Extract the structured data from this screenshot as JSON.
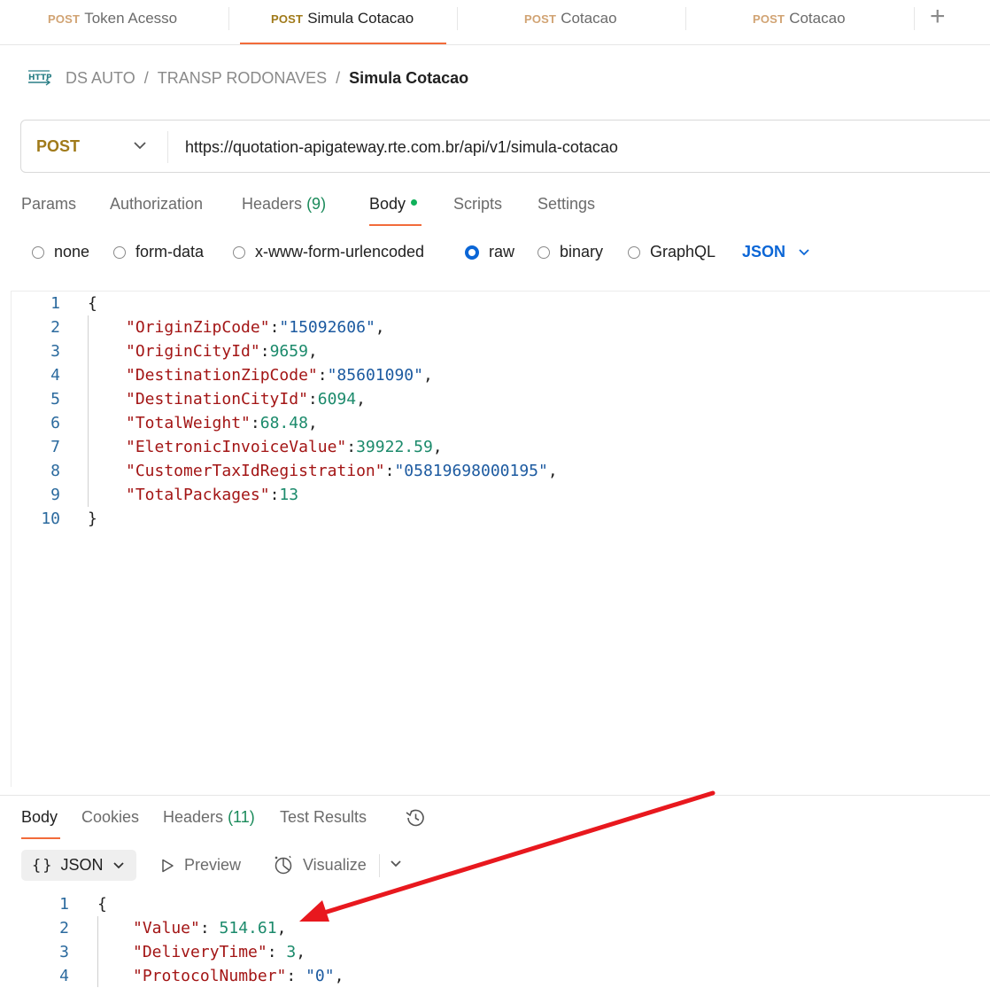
{
  "tabs": [
    {
      "method": "POST",
      "name": "Token Acesso",
      "active": false,
      "unsaved": false
    },
    {
      "method": "POST",
      "name": "Simula Cotacao",
      "active": true,
      "unsaved": true
    },
    {
      "method": "POST",
      "name": "Cotacao",
      "active": false,
      "unsaved": true
    },
    {
      "method": "POST",
      "name": "Cotacao",
      "active": false,
      "unsaved": false
    }
  ],
  "breadcrumb": {
    "icon": "http-icon",
    "parts": [
      "DS AUTO",
      "TRANSP RODONAVES"
    ],
    "separator": "/",
    "current": "Simula Cotacao"
  },
  "request": {
    "method": "POST",
    "url": "https://quotation-apigateway.rte.com.br/api/v1/simula-cotacao",
    "tabs": {
      "params": "Params",
      "authorization": "Authorization",
      "headers": "Headers",
      "headers_count": "(9)",
      "body": "Body",
      "scripts": "Scripts",
      "settings": "Settings"
    },
    "body_types": {
      "none": "none",
      "form_data": "form-data",
      "urlencoded": "x-www-form-urlencoded",
      "raw": "raw",
      "binary": "binary",
      "graphql": "GraphQL",
      "selected": "raw"
    },
    "format": "JSON",
    "body_lines": [
      {
        "n": "1",
        "k": "",
        "v": "",
        "t": "open"
      },
      {
        "n": "2",
        "k": "\"OriginZipCode\"",
        "v": "\"15092606\"",
        "t": "str",
        "c": ","
      },
      {
        "n": "3",
        "k": "\"OriginCityId\"",
        "v": "9659",
        "t": "num",
        "c": ","
      },
      {
        "n": "4",
        "k": "\"DestinationZipCode\"",
        "v": "\"85601090\"",
        "t": "str",
        "c": ","
      },
      {
        "n": "5",
        "k": "\"DestinationCityId\"",
        "v": "6094",
        "t": "num",
        "c": ","
      },
      {
        "n": "6",
        "k": "\"TotalWeight\"",
        "v": "68.48",
        "t": "num",
        "c": ","
      },
      {
        "n": "7",
        "k": "\"EletronicInvoiceValue\"",
        "v": "39922.59",
        "t": "num",
        "c": ","
      },
      {
        "n": "8",
        "k": "\"CustomerTaxIdRegistration\"",
        "v": "\"05819698000195\"",
        "t": "str",
        "c": ","
      },
      {
        "n": "9",
        "k": "\"TotalPackages\"",
        "v": "13",
        "t": "num",
        "c": ""
      },
      {
        "n": "10",
        "k": "",
        "v": "",
        "t": "close"
      }
    ]
  },
  "response": {
    "tabs": {
      "body": "Body",
      "cookies": "Cookies",
      "headers": "Headers",
      "headers_count": "(11)",
      "test_results": "Test Results"
    },
    "format_label": "JSON",
    "format_braces": "{}",
    "preview": "Preview",
    "visualize": "Visualize",
    "body_lines": [
      {
        "n": "1",
        "k": "",
        "v": "",
        "t": "open"
      },
      {
        "n": "2",
        "k": "\"Value\"",
        "v": "514.61",
        "t": "num",
        "c": ","
      },
      {
        "n": "3",
        "k": "\"DeliveryTime\"",
        "v": "3",
        "t": "num",
        "c": ","
      },
      {
        "n": "4",
        "k": "\"ProtocolNumber\"",
        "v": "\"0\"",
        "t": "str",
        "c": ","
      }
    ]
  },
  "colors": {
    "accent": "#f26b3a",
    "method": "#a07a1a",
    "link": "#0b66d6",
    "annotation_arrow": "#e8181e"
  }
}
